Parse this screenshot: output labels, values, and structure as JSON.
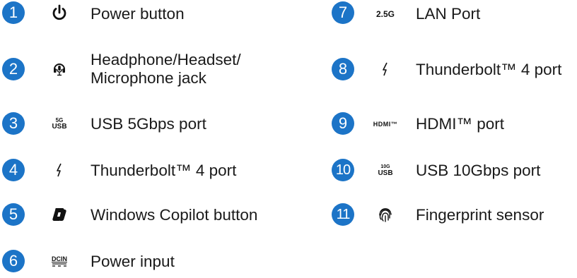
{
  "left_items": [
    {
      "num": "1",
      "icon": "power-icon",
      "label": "Power button"
    },
    {
      "num": "2",
      "icon": "headset-icon",
      "label_line1": "Headphone/Headset/",
      "label_line2": "Microphone jack"
    },
    {
      "num": "3",
      "icon": "usb-5g-icon",
      "icon_text_top": "5G",
      "icon_text_bottom": "USB",
      "label": "USB 5Gbps port"
    },
    {
      "num": "4",
      "icon": "thunderbolt-icon",
      "label": "Thunderbolt™ 4 port"
    },
    {
      "num": "5",
      "icon": "copilot-icon",
      "label": "Windows Copilot button"
    },
    {
      "num": "6",
      "icon": "dcin-icon",
      "icon_text": "DCIN",
      "label": "Power input"
    }
  ],
  "right_items": [
    {
      "num": "7",
      "icon": "lan-2-5g-icon",
      "icon_text": "2.5G",
      "label": "LAN Port"
    },
    {
      "num": "8",
      "icon": "thunderbolt-icon",
      "label": "Thunderbolt™ 4 port"
    },
    {
      "num": "9",
      "icon": "hdmi-icon",
      "icon_text": "HDMI™",
      "label": "HDMI™ port"
    },
    {
      "num": "10",
      "icon": "usb-10g-icon",
      "icon_text_top": "10G",
      "icon_text_bottom": "USB",
      "label": "USB 10Gbps port"
    },
    {
      "num": "11",
      "icon": "fingerprint-icon",
      "label": "Fingerprint sensor"
    }
  ],
  "colors": {
    "badge": "#1c74c7",
    "text": "#1a1a1a"
  }
}
